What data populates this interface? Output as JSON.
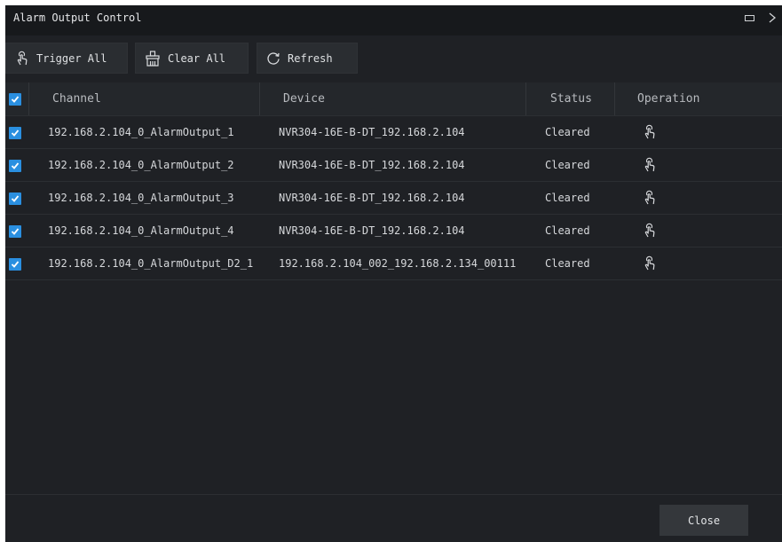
{
  "window": {
    "title": "Alarm Output Control"
  },
  "toolbar": {
    "trigger_all_label": "Trigger All",
    "clear_all_label": "Clear All",
    "refresh_label": "Refresh"
  },
  "table": {
    "headers": {
      "channel": "Channel",
      "device": "Device",
      "status": "Status",
      "operation": "Operation"
    },
    "select_all_checked": true,
    "rows": [
      {
        "checked": true,
        "channel": "192.168.2.104_0_AlarmOutput_1",
        "device": "NVR304-16E-B-DT_192.168.2.104",
        "status": "Cleared"
      },
      {
        "checked": true,
        "channel": "192.168.2.104_0_AlarmOutput_2",
        "device": "NVR304-16E-B-DT_192.168.2.104",
        "status": "Cleared"
      },
      {
        "checked": true,
        "channel": "192.168.2.104_0_AlarmOutput_3",
        "device": "NVR304-16E-B-DT_192.168.2.104",
        "status": "Cleared"
      },
      {
        "checked": true,
        "channel": "192.168.2.104_0_AlarmOutput_4",
        "device": "NVR304-16E-B-DT_192.168.2.104",
        "status": "Cleared"
      },
      {
        "checked": true,
        "channel": "192.168.2.104_0_AlarmOutput_D2_1",
        "device": "192.168.2.104_002_192.168.2.134_00111",
        "status": "Cleared"
      }
    ]
  },
  "footer": {
    "close_label": "Close"
  },
  "icons": {
    "trigger": "finger-tap-icon",
    "clear": "broom-icon",
    "refresh": "refresh-icon",
    "operation": "finger-tap-icon",
    "maximize": "maximize-icon",
    "close": "close-icon"
  },
  "colors": {
    "window_bg": "#1f2125",
    "titlebar_bg": "#17191c",
    "checkbox_accent": "#2a8fe0",
    "text": "#d6d8db"
  }
}
